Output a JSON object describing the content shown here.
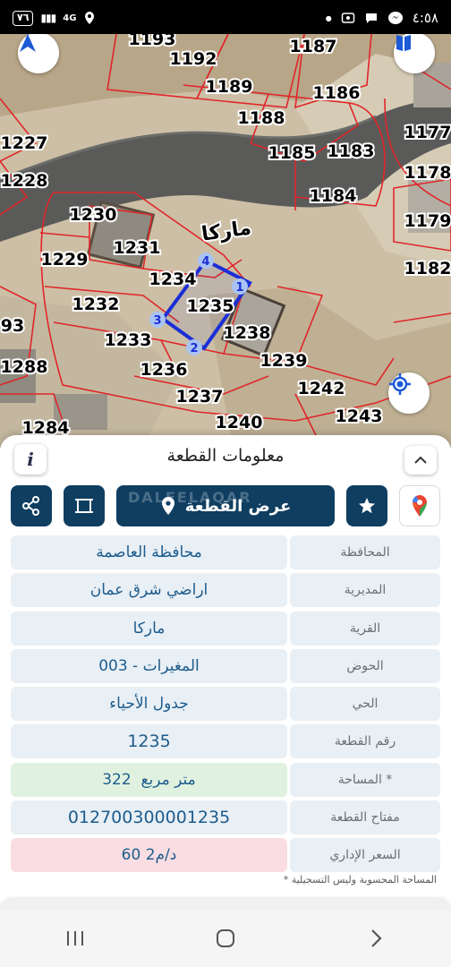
{
  "status_bar": {
    "battery": "٧٦",
    "network": "4G",
    "time": "٤:٥٨"
  },
  "map": {
    "street_name": "ماركا",
    "parcels": [
      {
        "num": "1193"
      },
      {
        "num": "1187"
      },
      {
        "num": "1192"
      },
      {
        "num": "1189"
      },
      {
        "num": "1186"
      },
      {
        "num": "1188"
      },
      {
        "num": "1177"
      },
      {
        "num": "1227"
      },
      {
        "num": "1185"
      },
      {
        "num": "1183"
      },
      {
        "num": "1178"
      },
      {
        "num": "1228"
      },
      {
        "num": "1184"
      },
      {
        "num": "1230"
      },
      {
        "num": "1179"
      },
      {
        "num": "1231"
      },
      {
        "num": "1229"
      },
      {
        "num": "1234"
      },
      {
        "num": "1182"
      },
      {
        "num": "1235"
      },
      {
        "num": "1232"
      },
      {
        "num": "93"
      },
      {
        "num": "1238"
      },
      {
        "num": "1233"
      },
      {
        "num": "1288"
      },
      {
        "num": "1239"
      },
      {
        "num": "1236"
      },
      {
        "num": "1242"
      },
      {
        "num": "1237"
      },
      {
        "num": "1243"
      },
      {
        "num": "1240"
      },
      {
        "num": "1284"
      }
    ],
    "vertices": [
      "1",
      "2",
      "3",
      "4"
    ]
  },
  "sheet": {
    "title": "معلومات القطعة",
    "info_label": "i",
    "show_parcel_label": "عرض القطعة",
    "watermark": "DALEELAQAR",
    "rows": [
      {
        "label": "المحافظة",
        "value": "محافظة العاصمة"
      },
      {
        "label": "المديرية",
        "value": "اراضي شرق عمان"
      },
      {
        "label": "القرية",
        "value": "ماركا"
      },
      {
        "label": "الحوض",
        "value": "المغيرات - 003"
      },
      {
        "label": "الحي",
        "value": "جدول الأحياء"
      },
      {
        "label": "رقم القطعة",
        "value": "1235"
      },
      {
        "label": "المساحة *",
        "value": "322  متر مربع"
      },
      {
        "label": "مفتاح القطعة",
        "value": "012700300001235"
      },
      {
        "label": "السعر الإداري",
        "value": "60 د/م2"
      }
    ],
    "footnote": "* المساحة المحسوبة وليس التسجيلية"
  },
  "colors": {
    "primary": "#0f3e61",
    "field_bg": "#e8eff5",
    "area_bg": "#e0f2df",
    "price_bg": "#f9dde2",
    "parcel_outline": "#e0262a",
    "selected_outline": "#1b2fd6"
  },
  "icons": {
    "navigation": "navigation-arrow-icon",
    "book": "book-icon",
    "locate": "my-location-icon",
    "share": "share-icon",
    "crop": "crop-square-icon",
    "pin": "location-pin-icon",
    "star": "star-icon",
    "maps": "google-maps-icon",
    "collapse": "chevron-up-icon"
  }
}
